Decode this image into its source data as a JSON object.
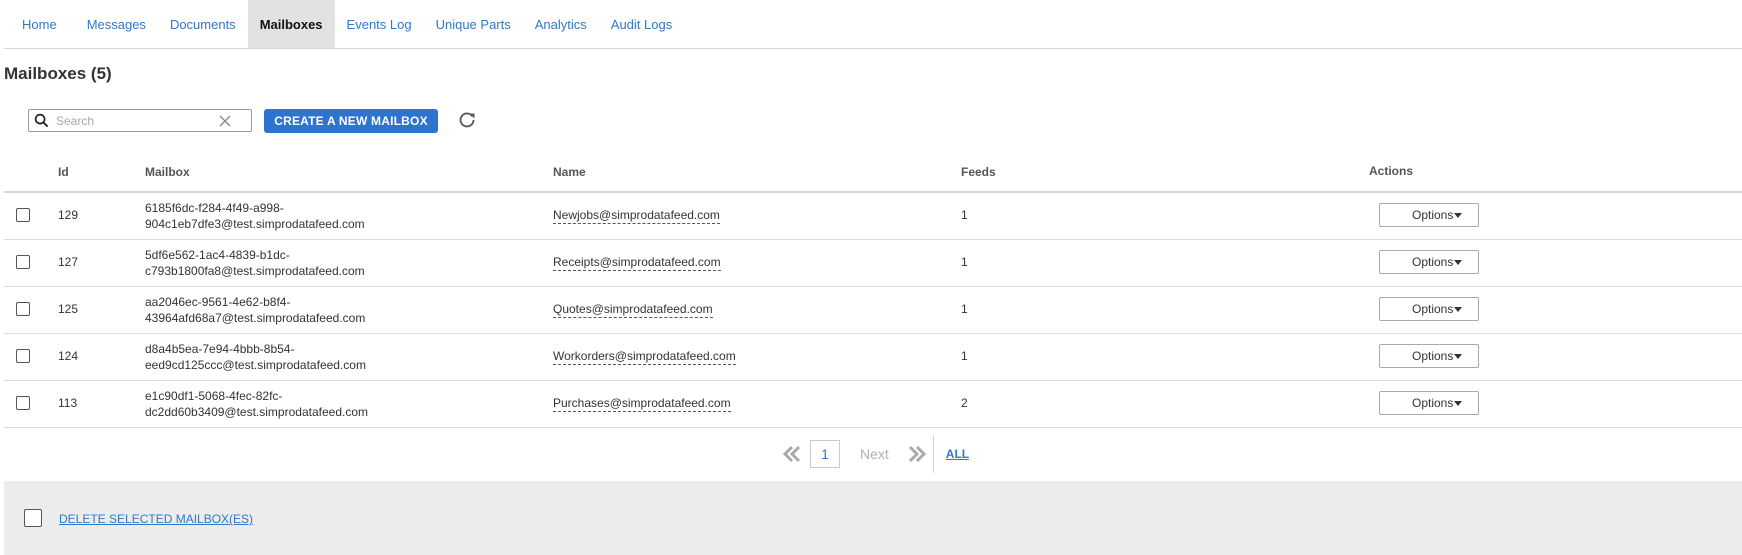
{
  "nav": {
    "tabs": [
      {
        "label": "Home"
      },
      {
        "label": "Messages"
      },
      {
        "label": "Documents"
      },
      {
        "label": "Mailboxes",
        "active": true
      },
      {
        "label": "Events Log"
      },
      {
        "label": "Unique Parts"
      },
      {
        "label": "Analytics"
      },
      {
        "label": "Audit Logs"
      }
    ]
  },
  "page": {
    "title": "Mailboxes (5)"
  },
  "toolbar": {
    "search_placeholder": "Search",
    "search_value": "",
    "create_label": "CREATE A NEW MAILBOX"
  },
  "table": {
    "headers": {
      "id": "Id",
      "mailbox": "Mailbox",
      "name": "Name",
      "feeds": "Feeds",
      "actions": "Actions"
    },
    "rows": [
      {
        "id": "129",
        "mailbox_line1": "6185f6dc-f284-4f49-a998-",
        "mailbox_line2": "904c1eb7dfe3@test.simprodatafeed.com",
        "name": "Newjobs@simprodatafeed.com",
        "feeds": "1",
        "action": "Options"
      },
      {
        "id": "127",
        "mailbox_line1": "5df6e562-1ac4-4839-b1dc-",
        "mailbox_line2": "c793b1800fa8@test.simprodatafeed.com",
        "name": "Receipts@simprodatafeed.com",
        "feeds": "1",
        "action": "Options"
      },
      {
        "id": "125",
        "mailbox_line1": "aa2046ec-9561-4e62-b8f4-",
        "mailbox_line2": "43964afd68a7@test.simprodatafeed.com",
        "name": "Quotes@simprodatafeed.com",
        "feeds": "1",
        "action": "Options"
      },
      {
        "id": "124",
        "mailbox_line1": "d8a4b5ea-7e94-4bbb-8b54-",
        "mailbox_line2": "eed9cd125ccc@test.simprodatafeed.com",
        "name": "Workorders@simprodatafeed.com",
        "feeds": "1",
        "action": "Options"
      },
      {
        "id": "113",
        "mailbox_line1": "e1c90df1-5068-4fec-82fc-",
        "mailbox_line2": "dc2dd60b3409@test.simprodatafeed.com",
        "name": "Purchases@simprodatafeed.com",
        "feeds": "2",
        "action": "Options"
      }
    ]
  },
  "pagination": {
    "current_page": "1",
    "next_label": "Next",
    "all_label": "ALL"
  },
  "footer": {
    "delete_label": "DELETE SELECTED MAILBOX(ES)"
  },
  "icons": {
    "search": "search-icon",
    "clear": "close-icon",
    "refresh": "refresh-icon",
    "prev": "double-chevron-left-icon",
    "next": "double-chevron-right-icon",
    "dropdown": "caret-down-icon"
  },
  "colors": {
    "accent": "#2d74cf",
    "link": "#2f79c6",
    "active_tab_bg": "#e2e2e2",
    "footer_bg": "#ececec"
  }
}
